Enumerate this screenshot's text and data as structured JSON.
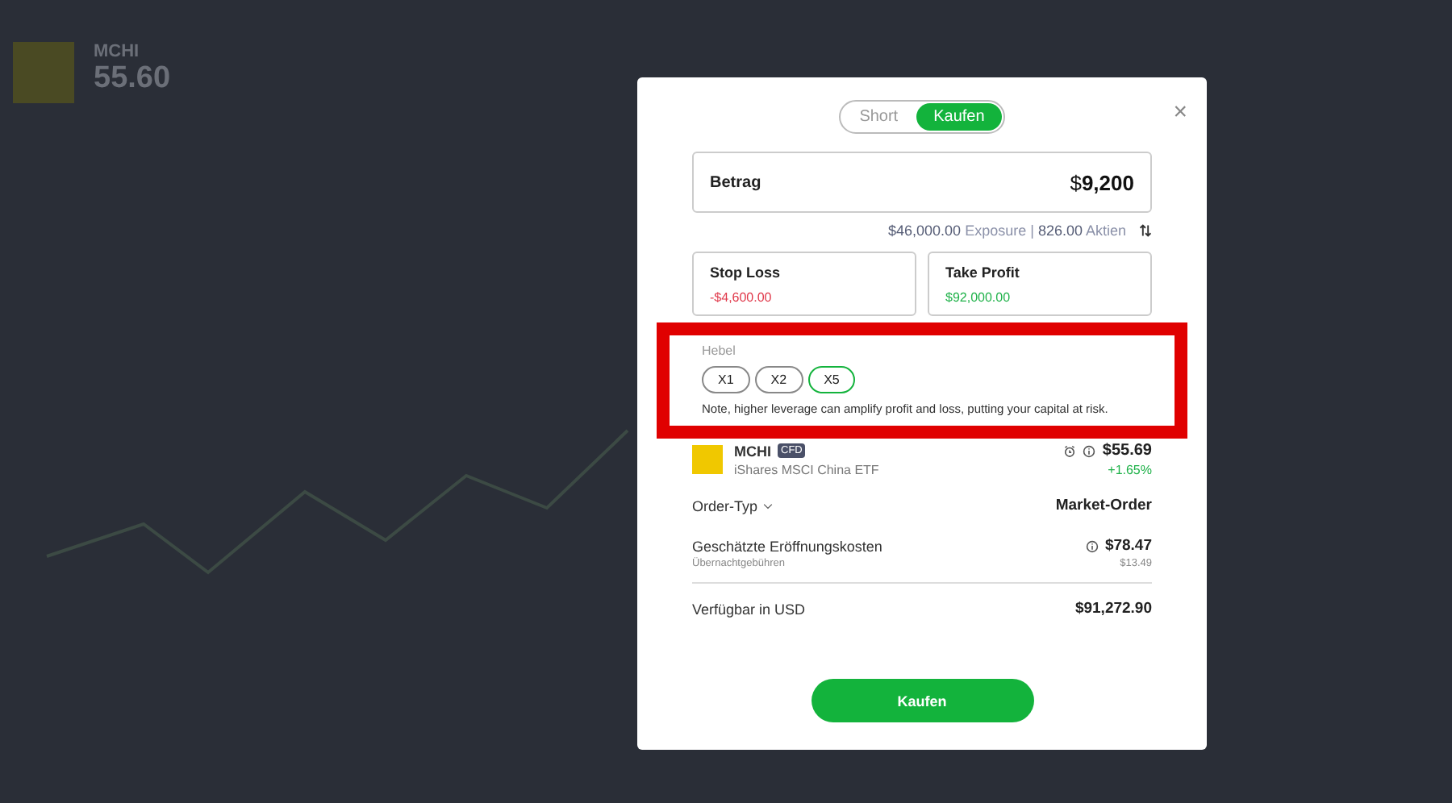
{
  "background": {
    "symbol": "MCHI",
    "price": "55.60"
  },
  "order_dialog": {
    "direction_tabs": [
      {
        "label": "Short",
        "selected": false
      },
      {
        "label": "Kaufen",
        "selected": true
      }
    ],
    "close": "×",
    "amount": {
      "label": "Betrag",
      "currency": "$",
      "value": "9,200"
    },
    "exposure": {
      "exposure_value": "$46,000.00",
      "exposure_label": "Exposure",
      "separator": "|",
      "shares_value": "826.00",
      "shares_label": "Aktien"
    },
    "stop_loss": {
      "label": "Stop Loss",
      "value": "-$4,600.00"
    },
    "take_profit": {
      "label": "Take Profit",
      "value": "$92,000.00"
    },
    "leverage": {
      "label": "Hebel",
      "highlighted": true,
      "options": [
        {
          "label": "X1",
          "selected": false
        },
        {
          "label": "X2",
          "selected": false
        },
        {
          "label": "X5",
          "selected": true
        }
      ],
      "note": "Note, higher leverage can amplify profit and loss, putting your capital at risk."
    },
    "instrument": {
      "symbol": "MCHI",
      "badge": "CFD",
      "name": "iShares MSCI China ETF",
      "price": "$55.69",
      "change": "+1.65%"
    },
    "order_type": {
      "label": "Order-Typ",
      "value": "Market-Order"
    },
    "costs": {
      "label": "Geschätzte Eröffnungskosten",
      "sublabel": "Übernachtgebühren",
      "value": "$78.47",
      "subvalue": "$13.49"
    },
    "available": {
      "label": "Verfügbar in USD",
      "value": "$91,272.90"
    },
    "submit": "Kaufen"
  }
}
